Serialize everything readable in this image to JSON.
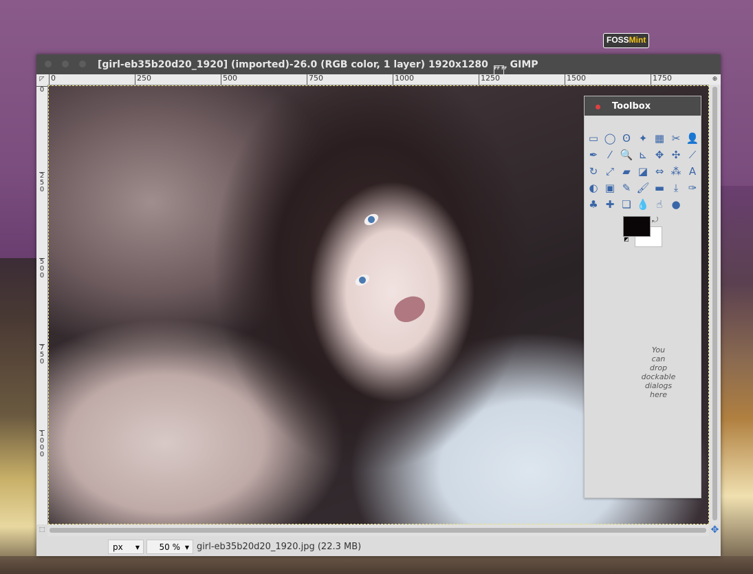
{
  "brand": {
    "prefix": "FOSS",
    "accent": "Mint"
  },
  "window": {
    "title": "[girl-eb35b20d20_1920] (imported)-26.0 (RGB color, 1 layer) 1920x1280",
    "title_icon": "FF FF",
    "app_name": "GIMP"
  },
  "ruler": {
    "h_ticks": [
      "0",
      "250",
      "500",
      "750",
      "1000",
      "1250",
      "1500",
      "1750"
    ],
    "v_ticks": [
      "0",
      "250",
      "500",
      "750",
      "1000"
    ]
  },
  "toolbox": {
    "title": "Toolbox",
    "drop_hint": "You\ncan\ndrop\ndockable\ndialogs\nhere",
    "tools": [
      "rect-select",
      "ellipse-select",
      "free-select",
      "fuzzy-select",
      "select-by-color",
      "scissors-select",
      "foreground-select",
      "paths",
      "color-picker",
      "zoom",
      "measure",
      "move",
      "align",
      "crop",
      "rotate",
      "scale",
      "shear",
      "perspective",
      "flip",
      "cage-transform",
      "text",
      "bucket-fill",
      "blend",
      "pencil",
      "paintbrush",
      "eraser",
      "airbrush",
      "ink",
      "clone",
      "heal",
      "perspective-clone",
      "blur",
      "smudge",
      "dodge-burn"
    ],
    "tool_glyphs": [
      "▭",
      "◯",
      "ʘ",
      "✦",
      "▦",
      "✂",
      "👤",
      "✒",
      "⁄",
      "🔍",
      "⊾",
      "✥",
      "✣",
      "⟋",
      "↻",
      "⤢",
      "▰",
      "◪",
      "⇔",
      "⁂",
      "A",
      "◐",
      "▣",
      "✎",
      "🖌",
      "▬",
      "⤓",
      "✑",
      "♣",
      "✚",
      "❏",
      "💧",
      "☝",
      "●"
    ],
    "fg_color": "#0a0506",
    "bg_color": "#ffffff"
  },
  "statusbar": {
    "unit": "px",
    "zoom": "50 %",
    "status": "girl-eb35b20d20_1920.jpg (22.3 MB)"
  }
}
